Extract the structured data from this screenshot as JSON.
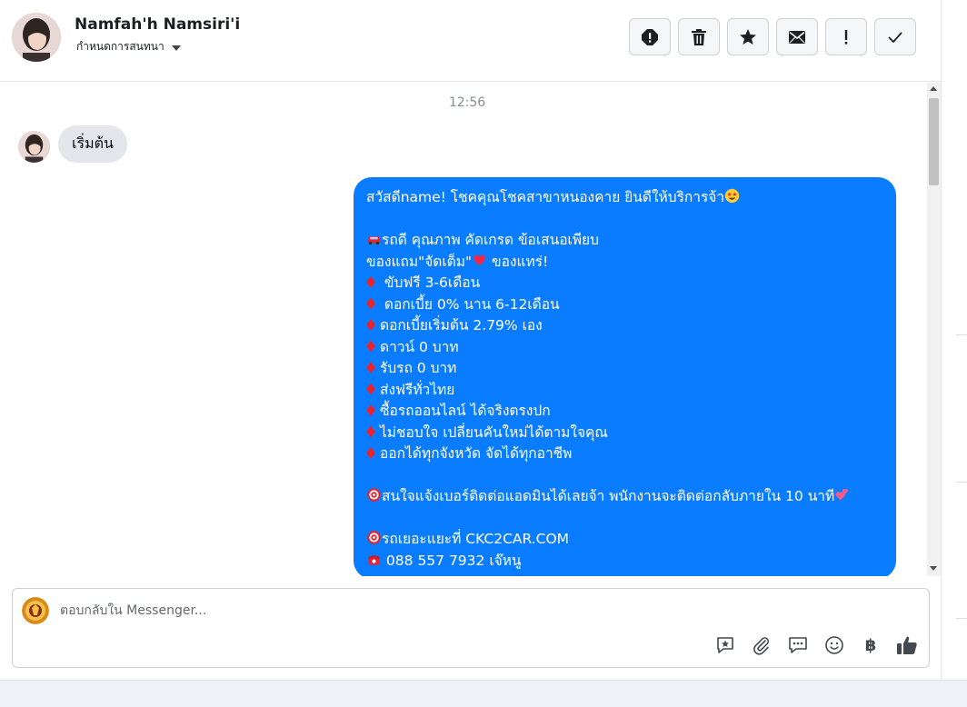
{
  "header": {
    "contact_name": "Namfah'h Namsiri'i",
    "conversation_menu_label": "กำหนดการสนทนา",
    "toolbar": [
      {
        "icon": "alert-circle-icon",
        "name": "spam-button"
      },
      {
        "icon": "trash-icon",
        "name": "delete-button"
      },
      {
        "icon": "star-icon",
        "name": "star-button"
      },
      {
        "icon": "envelope-icon",
        "name": "mark-unread-button"
      },
      {
        "icon": "exclamation-icon",
        "name": "follow-up-button"
      },
      {
        "icon": "check-icon",
        "name": "done-button"
      }
    ]
  },
  "thread": {
    "timestamp": "12:56",
    "incoming": {
      "text": "เริ่มต้น"
    },
    "outgoing_lines": [
      {
        "text": "สวัสดีname! โชคคุณโชคสาขาหนองคาย ยินดีให้บริการจ้า",
        "suffix_emoji": "star-struck-emoji"
      },
      {
        "text": ""
      },
      {
        "text": "รถดี คุณภาพ คัดเกรด ข้อเสนอเพียบ",
        "prefix_emoji": "car-emoji"
      },
      {
        "text": "ของแถม\"จัดเต็ม\"",
        "suffix_emoji": "heart-emoji",
        "tail": " ของแทร่!"
      },
      {
        "text": " ขับฟรี 3-6เดือน",
        "bullet": true
      },
      {
        "text": " ดอกเบี้ย 0% นาน 6-12เดือน",
        "bullet": true
      },
      {
        "text": "ดอกเบี้ยเริ่มต้น 2.79% เอง",
        "bullet": true
      },
      {
        "text": "ดาวน์ 0 บาท",
        "bullet": true
      },
      {
        "text": "รับรถ 0 บาท",
        "bullet": true
      },
      {
        "text": "ส่งฟรีทั่วไทย",
        "bullet": true
      },
      {
        "text": "ซื้อรถออนไลน์ ได้จริงตรงปก",
        "bullet": true
      },
      {
        "text": "ไม่ชอบใจ เปลี่ยนคันใหม่ได้ตามใจคุณ",
        "bullet": true
      },
      {
        "text": "ออกได้ทุกจังหวัด จัดได้ทุกอาชีพ",
        "bullet": true
      },
      {
        "text": ""
      },
      {
        "text": "สนใจแจ้งเบอร์ติดต่อแอดมินได้เลยจ้า พนักงานจะติดต่อกลับภายใน 10 นาที",
        "prefix_emoji": "target-emoji",
        "suffix_emoji": "two-hearts-emoji"
      },
      {
        "text": ""
      },
      {
        "text": "รถเยอะแยะที่ CKC2CAR.COM",
        "prefix_emoji": "target-emoji"
      },
      {
        "text": " 088 557 7932 เจ๊หนู",
        "prefix_emoji": "telephone-emoji"
      }
    ],
    "outgoing_color": "#0a7cff",
    "incoming_color": "#e4e6eb"
  },
  "composer": {
    "placeholder": "ตอบกลับใน Messenger...",
    "tools": [
      "saved-reply-icon",
      "paperclip-icon",
      "chat-bubbles-icon",
      "smiley-icon",
      "baht-icon",
      "thumbs-up-icon"
    ],
    "baht_symbol": "฿"
  }
}
